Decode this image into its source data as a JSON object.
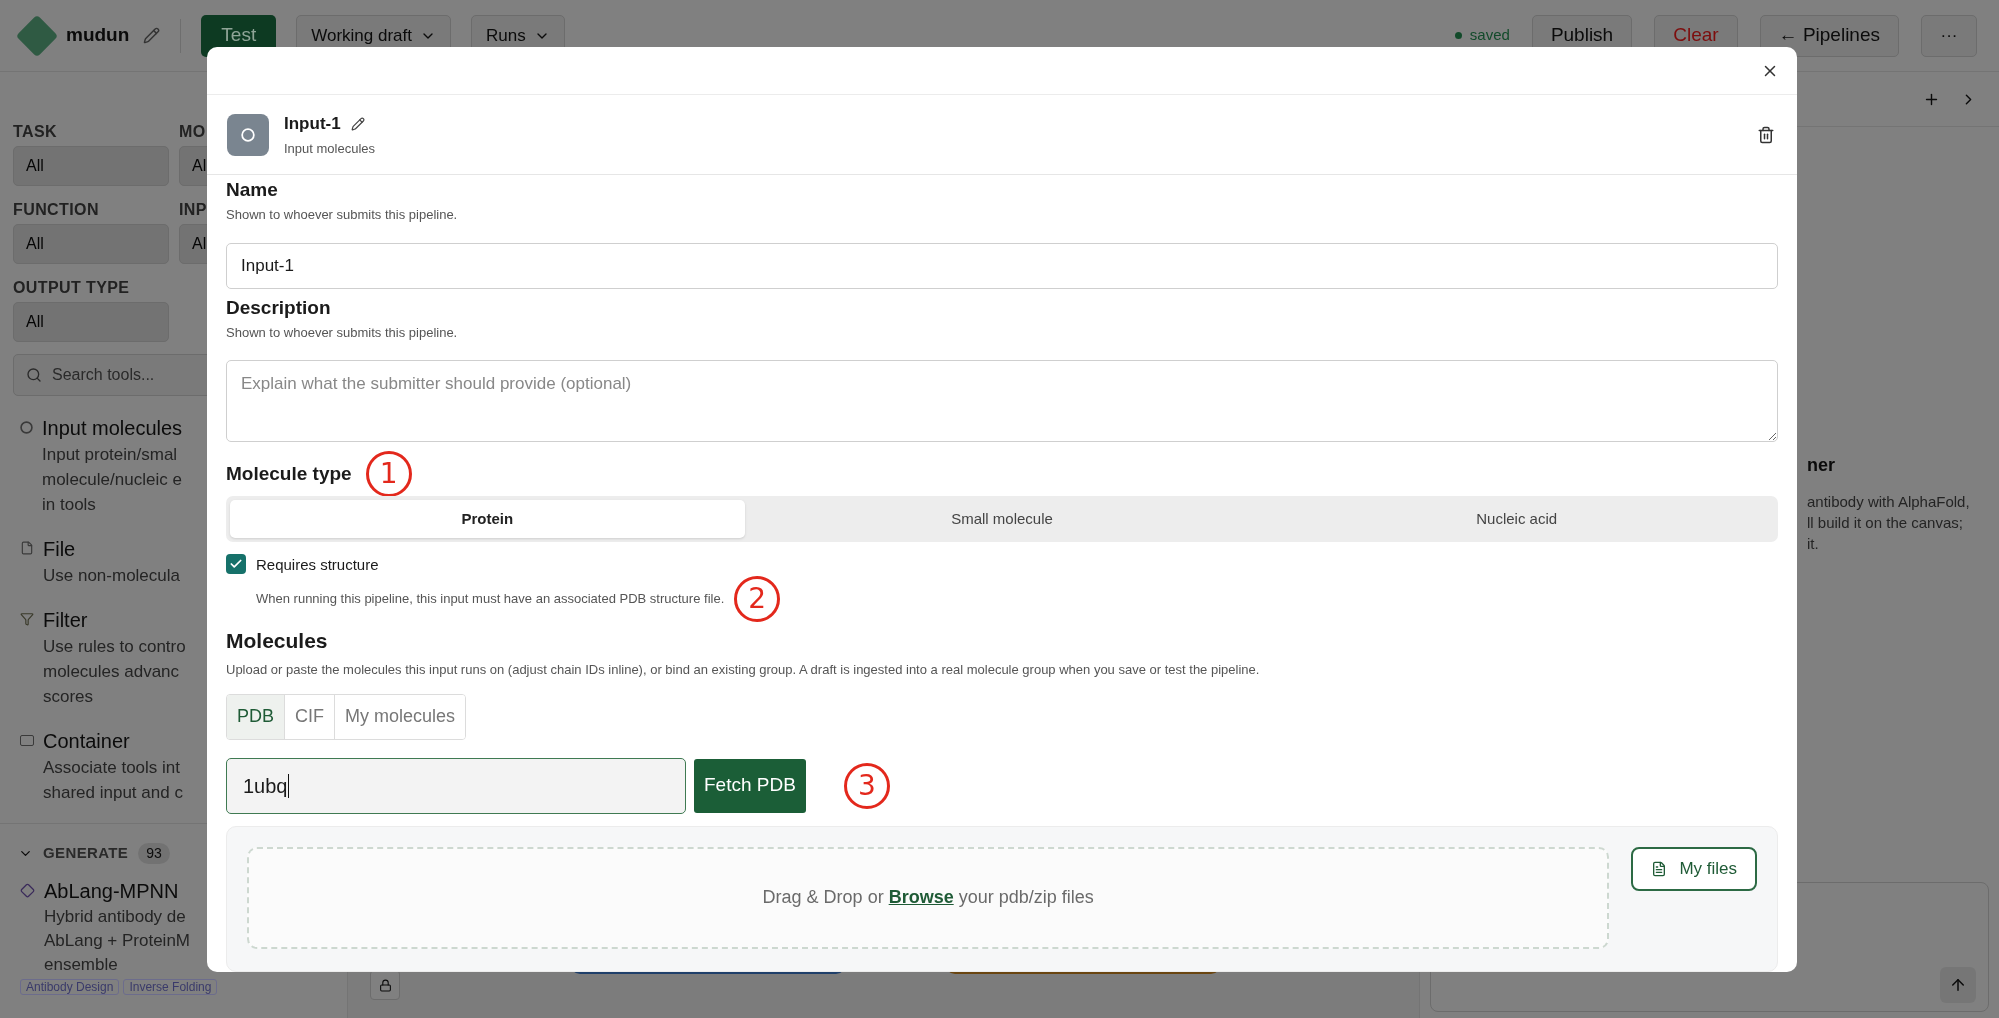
{
  "topbar": {
    "project": "mudun",
    "test_button": "Test",
    "draft_menu": "Working draft",
    "runs_menu": "Runs",
    "status": "saved",
    "publish": "Publish",
    "clear": "Clear",
    "pipelines": "← Pipelines",
    "more": "···"
  },
  "sidebar": {
    "filters": [
      {
        "label": "TASK",
        "value": "All"
      },
      {
        "label": "MO",
        "value": "Al"
      },
      {
        "label": "FUNCTION",
        "value": "All"
      },
      {
        "label": "INP",
        "value": "Al"
      },
      {
        "label": "OUTPUT TYPE",
        "value": "All"
      }
    ],
    "search": {
      "placeholder": "Search tools..."
    },
    "items": [
      {
        "kind": "input",
        "title": "Input molecules",
        "lines": [
          "Input protein/smal",
          "molecule/nucleic e",
          "in tools"
        ]
      },
      {
        "kind": "file",
        "title": "File",
        "lines": [
          "Use non-molecula"
        ]
      },
      {
        "kind": "filter",
        "title": "Filter",
        "lines": [
          "Use rules to contro",
          "molecules advanc",
          "scores"
        ]
      },
      {
        "kind": "container",
        "title": "Container",
        "lines": [
          "Associate tools int",
          "shared input and c"
        ]
      }
    ],
    "section": {
      "label": "GENERATE",
      "count": "93",
      "expanded": true
    },
    "tools": [
      {
        "title": "AbLang-MPNN",
        "lines": [
          "Hybrid antibody de",
          "AbLang + ProteinM",
          "ensemble"
        ],
        "tags": [
          "Antibody Design",
          "Inverse Folding"
        ]
      }
    ]
  },
  "right_panel": {
    "title": "ner",
    "lines": [
      "antibody with AlphaFold,",
      "ll build it on the canvas;",
      "it."
    ]
  },
  "modal": {
    "node_title": "Input-1",
    "node_subtitle": "Input molecules",
    "name": {
      "label": "Name",
      "hint": "Shown to whoever submits this pipeline.",
      "value": "Input-1"
    },
    "description": {
      "label": "Description",
      "hint": "Shown to whoever submits this pipeline.",
      "placeholder": "Explain what the submitter should provide (optional)"
    },
    "molecule_type": {
      "label": "Molecule type",
      "annotation": "1",
      "options": [
        {
          "label": "Protein",
          "selected": true
        },
        {
          "label": "Small molecule",
          "selected": false
        },
        {
          "label": "Nucleic acid",
          "selected": false
        }
      ]
    },
    "requires_structure": {
      "label": "Requires structure",
      "hint": "When running this pipeline, this input must have an associated PDB structure file.",
      "checked": true,
      "annotation": "2"
    },
    "molecules": {
      "label": "Molecules",
      "hint": "Upload or paste the molecules this input runs on (adjust chain IDs inline), or bind an existing group. A draft is ingested into a real molecule group when you save or test the pipeline.",
      "tabs": [
        {
          "label": "PDB",
          "selected": true
        },
        {
          "label": "CIF",
          "selected": false
        },
        {
          "label": "My molecules",
          "selected": false
        }
      ],
      "pdb_value": "1ubq",
      "fetch_button": "Fetch PDB",
      "annotation": "3",
      "drop_prefix": "Drag & Drop or",
      "drop_link": "Browse",
      "drop_suffix": "your pdb/zip files",
      "files_button": "My files"
    }
  }
}
